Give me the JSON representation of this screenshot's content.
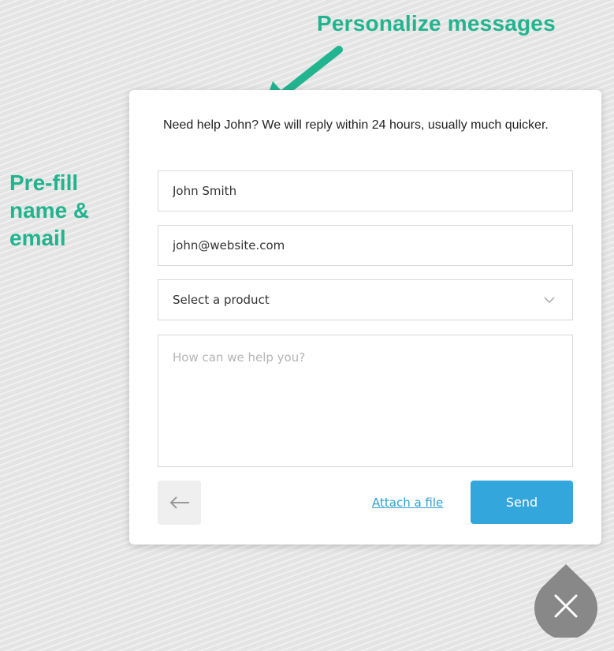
{
  "annotations": {
    "top": "Personalize messages",
    "left": "Pre-fill name & email"
  },
  "form": {
    "intro": "Need help John? We will reply within 24 hours, usually much quicker.",
    "name_value": "John Smith",
    "email_value": "john@website.com",
    "product_select": "Select a product",
    "message_placeholder": "How can we help you?",
    "attach_label": "Attach a file",
    "send_label": "Send"
  },
  "icons": {
    "back": "arrow-left-icon",
    "select": "chevron-down-icon",
    "close": "close-icon"
  },
  "colors": {
    "annotation": "#21b48f",
    "send_button": "#33a6dc",
    "link": "#2f9fd4",
    "close_bubble": "#888888"
  }
}
